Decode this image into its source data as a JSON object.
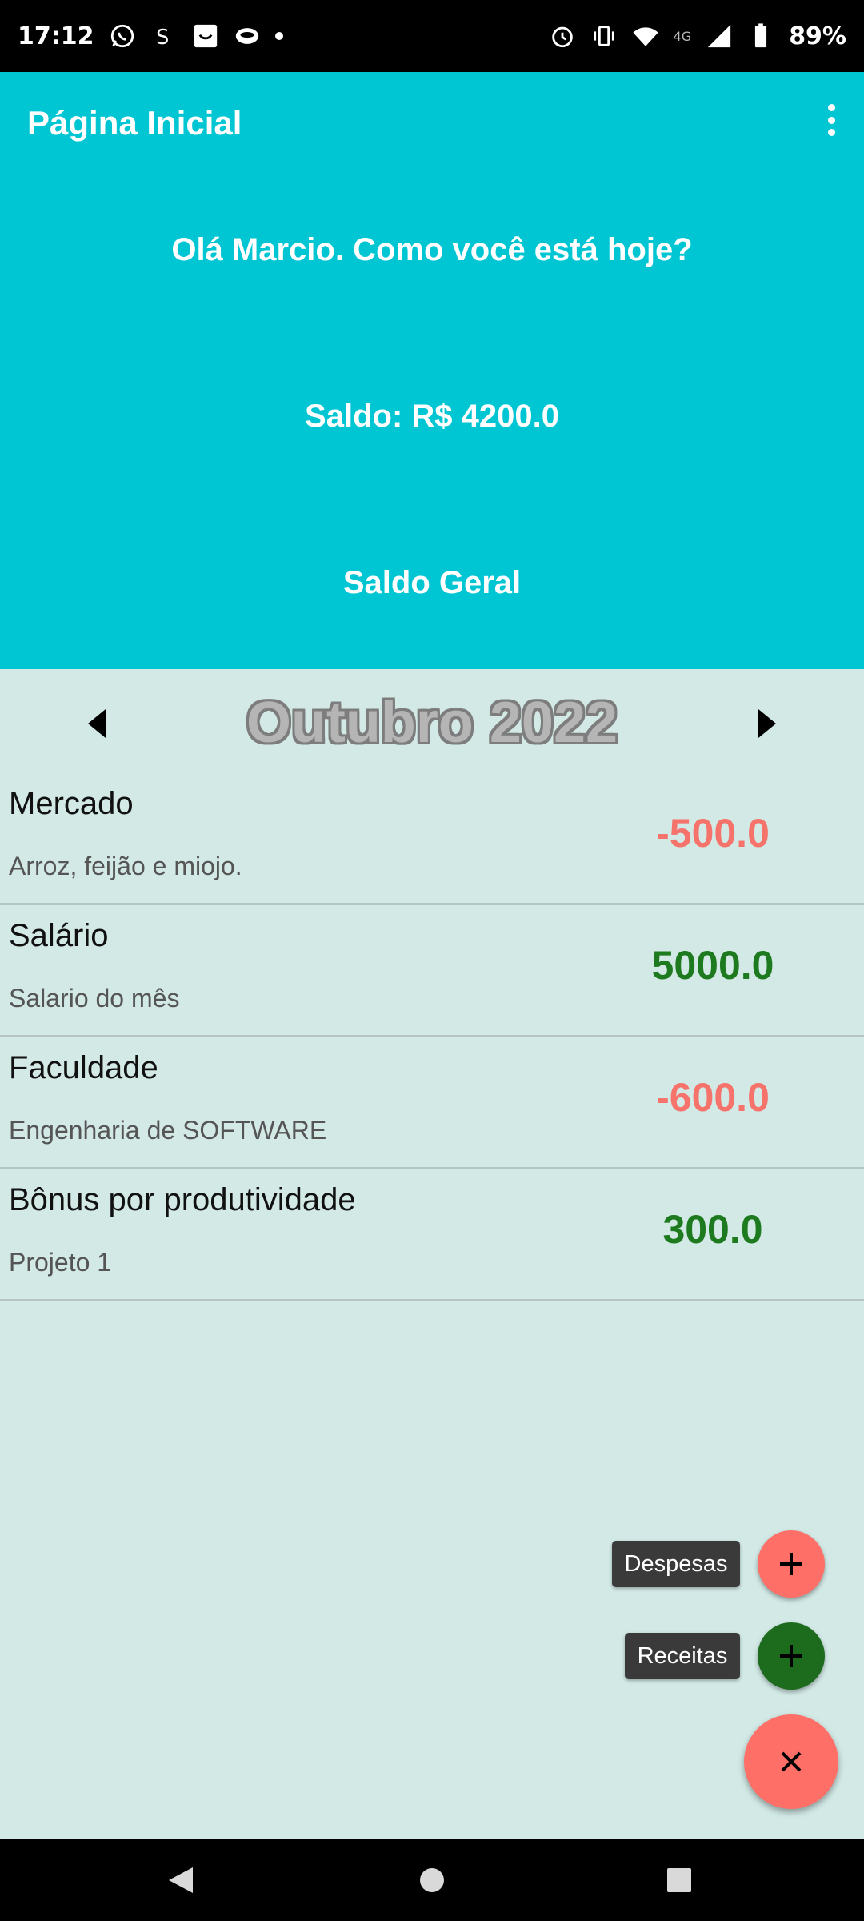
{
  "status_bar": {
    "time": "17:12",
    "network": "4G",
    "battery": "89%",
    "icons": [
      "whatsapp-icon",
      "sim-icon",
      "shopping-icon",
      "app-icon",
      "notification-dot",
      "alarm-icon",
      "vibrate-icon",
      "wifi-icon",
      "signal-icon",
      "battery-icon"
    ]
  },
  "app_bar": {
    "title": "Página Inicial",
    "menu_icon": "more-vert-icon"
  },
  "header": {
    "greeting": "Olá Marcio. Como você está hoje?",
    "balance": "Saldo: R$ 4200.0",
    "balance_mode": "Saldo Geral"
  },
  "month_selector": {
    "label": "Outubro 2022",
    "prev_icon": "arrow-left-icon",
    "next_icon": "arrow-right-icon"
  },
  "transactions": [
    {
      "title": "Mercado",
      "description": "Arroz, feijão e miojo.",
      "amount": "-500.0",
      "type": "expense"
    },
    {
      "title": "Salário",
      "description": "Salario do mês",
      "amount": "5000.0",
      "type": "income"
    },
    {
      "title": "Faculdade",
      "description": "Engenharia de SOFTWARE",
      "amount": "-600.0",
      "type": "expense"
    },
    {
      "title": "Bônus por produtividade",
      "description": "Projeto 1",
      "amount": "300.0",
      "type": "income"
    }
  ],
  "fab": {
    "expenses_label": "Despesas",
    "income_label": "Receitas",
    "close_icon": "close-icon"
  },
  "colors": {
    "header_bg": "#00c5d2",
    "page_bg": "#d2e9e6",
    "expense": "#f5736b",
    "income": "#1e7a1e",
    "fab_expense": "#fe6f67",
    "fab_income": "#1d6b1d"
  },
  "nav_bar": {
    "back_icon": "back-icon",
    "home_icon": "home-icon",
    "recents_icon": "recents-icon"
  }
}
